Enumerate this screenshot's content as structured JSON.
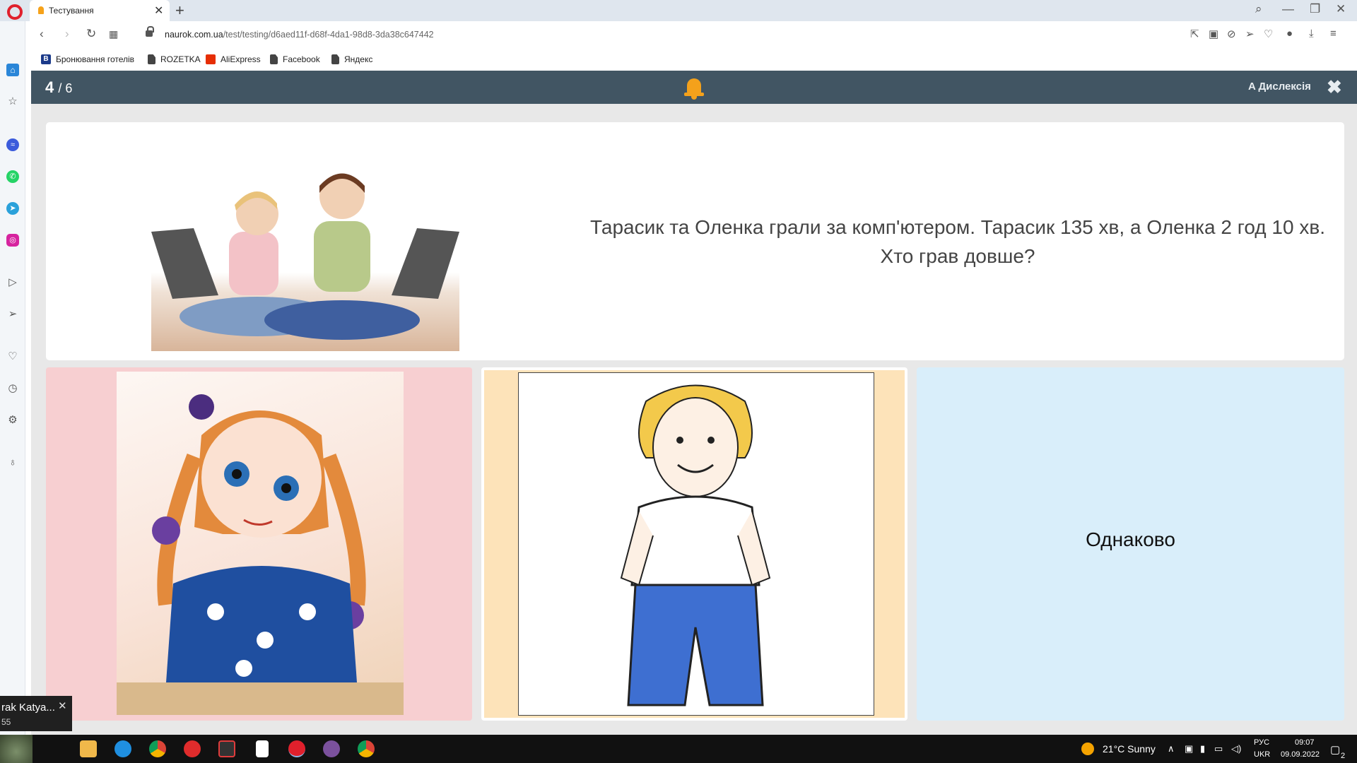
{
  "browser": {
    "tab_title": "Тестування",
    "url_domain": "naurok.com.ua",
    "url_path": "/test/testing/d6aed11f-d68f-4da1-98d8-3da38c647442",
    "bookmarks": [
      {
        "label": "Бронювання готелів",
        "icon": "booking-icon"
      },
      {
        "label": "ROZETKA",
        "icon": "folder-icon"
      },
      {
        "label": "AliExpress",
        "icon": "aliexpress-icon"
      },
      {
        "label": "Facebook",
        "icon": "folder-icon"
      },
      {
        "label": "Яндекс",
        "icon": "folder-icon"
      }
    ]
  },
  "header": {
    "current": "4",
    "total": "/ 6",
    "dyslexia_label": "A Дислексія",
    "bell_color": "#f4a11b"
  },
  "question": {
    "text": "Тарасик та Оленка грали за комп'ютером. Тарасик 135 хв, а Оленка 2 год 10 хв. Хто грав довше?"
  },
  "options": [
    {
      "type": "image",
      "icon": "girl-illustration",
      "color": "#f7cfd1"
    },
    {
      "type": "image",
      "icon": "boy-illustration",
      "color": "#fde3b9"
    },
    {
      "type": "text",
      "label": "Однаково",
      "color": "#d9eefa"
    }
  ],
  "notification": {
    "title": "rak Katya...",
    "subtitle": "55"
  },
  "taskbar": {
    "weather": "21°C  Sunny",
    "language_top": "РУС",
    "language_bottom": "UKR",
    "time": "09:07",
    "date": "09.09.2022",
    "notification_count": "2"
  }
}
